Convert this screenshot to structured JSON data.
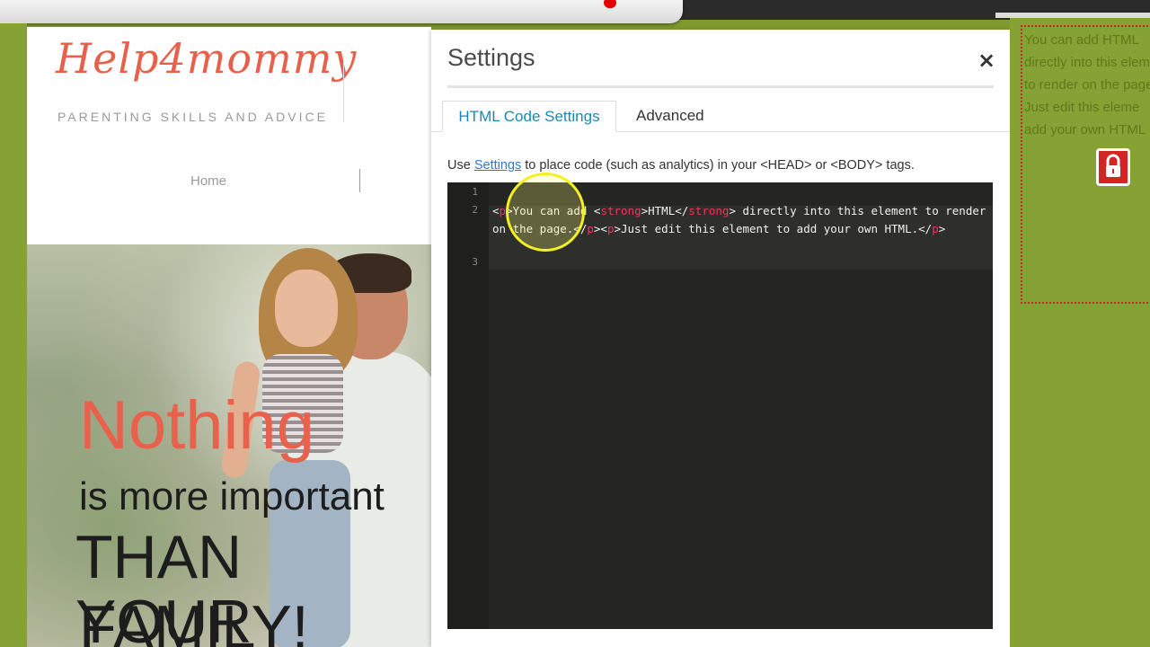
{
  "site": {
    "logo_text": "Help4mommy",
    "tagline": "PARENTING SKILLS AND ADVICE",
    "nav": {
      "home": "Home"
    },
    "hero": {
      "line1": "Nothing",
      "line2": "is more important",
      "line3": "THAN YOUR",
      "line4": "FAMILY!"
    }
  },
  "dialog": {
    "title": "Settings",
    "close_glyph": "×",
    "tabs": [
      {
        "label": "HTML Code Settings",
        "active": true
      },
      {
        "label": "Advanced",
        "active": false
      }
    ],
    "intro": {
      "before": "Use ",
      "link": "Settings",
      "after": " to place code (such as analytics) in your <HEAD> or <BODY> tags."
    },
    "editor": {
      "line_numbers": [
        "1",
        "2",
        "3"
      ],
      "code_line2_segments": [
        {
          "text": "<",
          "kind": "tag"
        },
        {
          "text": "p",
          "kind": "tn"
        },
        {
          "text": ">You can add ",
          "kind": "tag"
        },
        {
          "text": "<",
          "kind": "tag"
        },
        {
          "text": "strong",
          "kind": "tn"
        },
        {
          "text": ">HTML</",
          "kind": "tag"
        },
        {
          "text": "strong",
          "kind": "tn"
        },
        {
          "text": "> directly into this element to render on the page.</",
          "kind": "tag"
        },
        {
          "text": "p",
          "kind": "tn"
        },
        {
          "text": "><",
          "kind": "tag"
        },
        {
          "text": "p",
          "kind": "tn"
        },
        {
          "text": ">Just edit this element to add your own HTML.</",
          "kind": "tag"
        },
        {
          "text": "p",
          "kind": "tn"
        },
        {
          "text": ">",
          "kind": "tag"
        }
      ]
    }
  },
  "right_panel": {
    "preview_lines": [
      "You can add HTML",
      "directly into this eleme",
      "to render on the page.",
      "Just edit this eleme",
      "add your own HTML"
    ],
    "lock_icon": "lock-icon"
  },
  "colors": {
    "accent_tab": "#1c87b7",
    "logo": "#e8604a",
    "background_green": "#7f9a2f",
    "code_tag": "#f2355a"
  }
}
